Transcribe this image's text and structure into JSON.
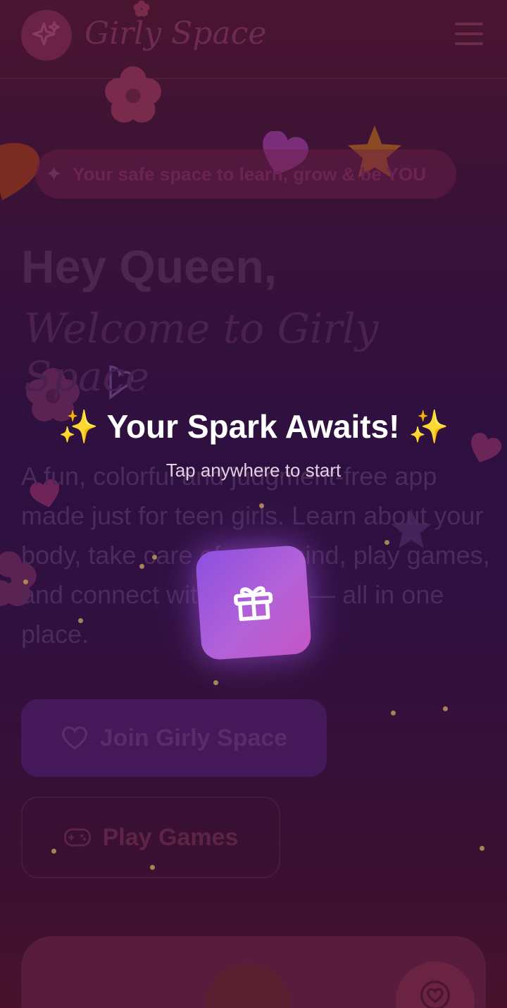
{
  "header": {
    "app_name": "Girly Space",
    "logo_icon": "sparkles-icon",
    "menu_icon": "hamburger-icon"
  },
  "hero": {
    "tagline": "Your safe space to learn, grow & be YOU",
    "greeting": "Hey Queen,",
    "welcome": "Welcome to Girly Space",
    "description": "A fun, colorful and judgment-free app made just for teen girls. Learn about your body, take care of your mind, play games, and connect with support — all in one place."
  },
  "actions": {
    "join_label": "Join Girly Space",
    "join_icon": "heart-icon",
    "play_label": "Play Games",
    "play_icon": "gamepad-icon"
  },
  "overlay": {
    "title": "Your Spark Awaits!",
    "title_emoji": "✨",
    "subtitle": "Tap anywhere to start",
    "gift_icon": "gift-icon"
  },
  "colors": {
    "gift_gradient_start": "#8c50e0",
    "gift_gradient_end": "#c555c6",
    "sparkle": "#f5c33b"
  }
}
